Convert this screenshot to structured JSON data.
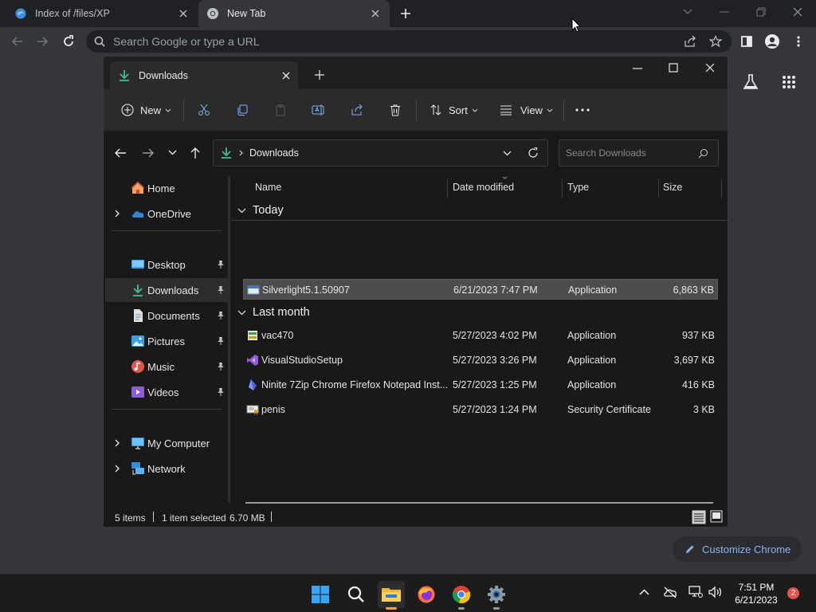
{
  "chrome": {
    "tabs": [
      {
        "label": "Index of /files/XP",
        "icon": "edge-page-icon"
      },
      {
        "label": "New Tab",
        "icon": "chrome-icon"
      }
    ],
    "omnibox_placeholder": "Search Google or type a URL",
    "customize_label": "Customize Chrome"
  },
  "explorer": {
    "tab_label": "Downloads",
    "commands": {
      "new": "New",
      "sort": "Sort",
      "view": "View"
    },
    "address": "Downloads",
    "search_placeholder": "Search Downloads",
    "nav": {
      "home": "Home",
      "onedrive": "OneDrive",
      "desktop": "Desktop",
      "downloads": "Downloads",
      "documents": "Documents",
      "pictures": "Pictures",
      "music": "Music",
      "videos": "Videos",
      "mycomputer": "My Computer",
      "network": "Network"
    },
    "columns": {
      "name": "Name",
      "date": "Date modified",
      "type": "Type",
      "size": "Size"
    },
    "groups": {
      "today": "Today",
      "last_month": "Last month"
    },
    "files": [
      {
        "name": "Silverlight5.1.50907",
        "date": "6/21/2023 7:47 PM",
        "type": "Application",
        "size": "6,863 KB",
        "icon": "app-window-icon"
      },
      {
        "name": "vac470",
        "date": "5/27/2023 4:02 PM",
        "type": "Application",
        "size": "937 KB",
        "icon": "installer-icon"
      },
      {
        "name": "VisualStudioSetup",
        "date": "5/27/2023 3:26 PM",
        "type": "Application",
        "size": "3,697 KB",
        "icon": "visual-studio-icon"
      },
      {
        "name": "Ninite 7Zip Chrome Firefox Notepad Inst...",
        "date": "5/27/2023 1:25 PM",
        "type": "Application",
        "size": "416 KB",
        "icon": "ninite-icon"
      },
      {
        "name": "penis",
        "date": "5/27/2023 1:24 PM",
        "type": "Security Certificate",
        "size": "3 KB",
        "icon": "certificate-icon"
      }
    ],
    "status": {
      "items": "5 items",
      "selected": "1 item selected",
      "size": "6.70 MB"
    }
  },
  "taskbar": {
    "time": "7:51 PM",
    "date": "6/21/2023",
    "notifications": "2"
  },
  "colors": {
    "accent": "#8ab4f8",
    "chrome_dark": "#202124",
    "selection": "#4d4d4d"
  }
}
